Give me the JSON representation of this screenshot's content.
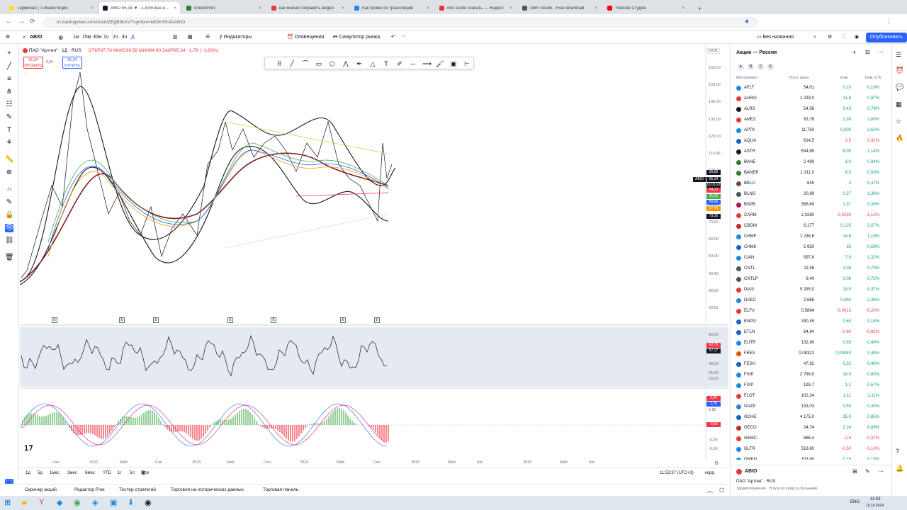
{
  "browser": {
    "tabs": [
      {
        "label": "Терминал | Т‑Инвестиции",
        "color": "#ffdd2d"
      },
      {
        "label": "ABIO 95,34 ▼ −1,83% Без назв",
        "color": "#131722",
        "active": true
      },
      {
        "label": "GreenPrint",
        "color": "#2e7d32"
      },
      {
        "label": "как можно сохранить видео",
        "color": "#e53935"
      },
      {
        "label": "Как провести трансляцию",
        "color": "#1e88e5"
      },
      {
        "label": "obs studio скачать — Яндекс",
        "color": "#e53935"
      },
      {
        "label": "OBS Studio - Free download",
        "color": "#455a64"
      },
      {
        "label": "Youtube Студия",
        "color": "#ff0000"
      }
    ],
    "url": "ru.tradingview.com/chart/ZEgB5kXv/?symbol=MOEX%3AABIO"
  },
  "toolbar": {
    "symbol": "ABIO",
    "intervals": [
      "1м",
      "15м",
      "30м",
      "1ч",
      "2ч",
      "4ч",
      "Д"
    ],
    "indicators": "Индикаторы",
    "alerts": "Оповещения",
    "replay": "Симулятор рынка",
    "layout_name": "Без названия",
    "publish": "Опубликовать"
  },
  "chart": {
    "legend_title": "ПАО \"Артген\" · 1Д · RUS",
    "ohlc": "ОТКР97,78 МАКС99,58 МИН94,90 ЗАКР95,34 −1,78 (−1,83%)",
    "sell_price": "95,34",
    "sell_label": "ПРОДАТЬ",
    "spread": "0,00",
    "buy_price": "95,34",
    "buy_label": "КУПИТЬ",
    "currency": "RUB",
    "price_axis": [
      "160,00",
      "150,00",
      "140,00",
      "130,00",
      "120,00",
      "110,00",
      "100,00",
      "90,00",
      "80,00",
      "70,00",
      "60,00",
      "50,00",
      "40,00",
      "30,00",
      "20,00"
    ],
    "price_tags": [
      {
        "text": "99,89",
        "color": "#131722"
      },
      {
        "text": "95,34",
        "color": "#131722"
      },
      {
        "text": "11:06:22",
        "color": "#131722"
      },
      {
        "text": "94,23",
        "color": "#f23645"
      },
      {
        "text": "91,22",
        "color": "#4caf50"
      },
      {
        "text": "89,60",
        "color": "#2962ff"
      },
      {
        "text": "87,49",
        "color": "#ff9800"
      },
      {
        "text": "73,35",
        "color": "#131722"
      }
    ],
    "symbol_tag": "ABIO",
    "rsi_axis": [
      "80,00",
      "40,00",
      "20,00"
    ],
    "rsi_tags": [
      {
        "text": "62,75",
        "color": "#f23645"
      },
      {
        "text": "57,17",
        "color": "#131722"
      }
    ],
    "rsi_extra": "25,63",
    "macd_axis": [
      "2,50",
      "-2,50",
      "-5,00"
    ],
    "macd_tags": [
      {
        "text": "3,94",
        "color": "#f23645"
      },
      {
        "text": "2,76",
        "color": "#2962ff"
      },
      {
        "text": "-0,18",
        "color": "#f23645"
      }
    ],
    "time_axis": [
      "Сен",
      "2022",
      "Май",
      "Сен",
      "2023",
      "Май",
      "Сен",
      "2024",
      "Май",
      "Сен",
      "2025",
      "Май",
      "Авг",
      "2026",
      "Май",
      "Авг"
    ],
    "earnings_marker": "E",
    "bottom_ranges": [
      "1д",
      "5д",
      "1мес",
      "3мес",
      "6мес",
      "YTD",
      "1г",
      "5л",
      "Все"
    ],
    "clock": "11:53:37 (UTC+3)",
    "adj": "корр."
  },
  "bottom_panels": [
    "Скринер акций",
    "Редактор Pine",
    "Тестер стратегий",
    "Торговля на исторических данных",
    "Торговая панель"
  ],
  "watchlist": {
    "title": "Акции — Россия",
    "columns": [
      "Инструмент",
      "Посл. цена",
      "Изм.",
      "Изм. в %"
    ],
    "rows": [
      {
        "sym": "AFLT",
        "price": "54,01",
        "ch": "0,10",
        "chp": "0,19%",
        "dir": "pos",
        "ic": "#1e88e5"
      },
      {
        "sym": "AGRO",
        "price": "1 233,0",
        "ch": "11,8",
        "chp": "0,97%",
        "dir": "pos",
        "ic": "#e53935"
      },
      {
        "sym": "ALRS",
        "price": "54,56",
        "ch": "0,43",
        "chp": "0,79%",
        "dir": "pos",
        "ic": "#131722"
      },
      {
        "sym": "AMEZ",
        "price": "93,78",
        "ch": "2,38",
        "chp": "2,60%",
        "dir": "pos",
        "ic": "#e53935"
      },
      {
        "sym": "APTK",
        "price": "11,750",
        "ch": "0,300",
        "chp": "2,62%",
        "dir": "pos",
        "ic": "#1e88e5"
      },
      {
        "sym": "AQUA",
        "price": "614,5",
        "ch": "2,5",
        "chp": "0,41%",
        "dir": "neg",
        "ic": "#1565c0"
      },
      {
        "sym": "ASTR",
        "price": "534,65",
        "ch": "6,05",
        "chp": "1,14%",
        "dir": "pos",
        "ic": "#131722"
      },
      {
        "sym": "BANE",
        "price": "2 490",
        "ch": "1,0",
        "chp": "0,04%",
        "dir": "pos",
        "ic": "#2e7d32"
      },
      {
        "sym": "BANEP",
        "price": "1 311,0",
        "ch": "6,5",
        "chp": "0,50%",
        "dir": "pos",
        "ic": "#2e7d32"
      },
      {
        "sym": "BELU",
        "price": "645",
        "ch": "3",
        "chp": "0,47%",
        "dir": "pos",
        "ic": "#6d4c41"
      },
      {
        "sym": "BLNG",
        "price": "20,89",
        "ch": "0,27",
        "chp": "1,36%",
        "dir": "pos",
        "ic": "#455a64"
      },
      {
        "sym": "BSPB",
        "price": "356,69",
        "ch": "1,37",
        "chp": "0,39%",
        "dir": "pos",
        "ic": "#ad1457"
      },
      {
        "sym": "CARM",
        "price": "2,0280",
        "ch": "-0,0230",
        "chp": "-1,12%",
        "dir": "neg",
        "ic": "#e53935"
      },
      {
        "sym": "CBOM",
        "price": "6,177",
        "ch": "0,125",
        "chp": "2,07%",
        "dir": "pos",
        "ic": "#c62828"
      },
      {
        "sym": "CHMF",
        "price": "1 238,6",
        "ch": "14,6",
        "chp": "1,19%",
        "dir": "pos",
        "ic": "#1e88e5"
      },
      {
        "sym": "CHMK",
        "price": "5 950",
        "ch": "35",
        "chp": "0,59%",
        "dir": "pos",
        "ic": "#1565c0"
      },
      {
        "sym": "CIAN",
        "price": "597,8",
        "ch": "7,8",
        "chp": "1,32%",
        "dir": "pos",
        "ic": "#1e88e5"
      },
      {
        "sym": "CNTL",
        "price": "11,58",
        "ch": "0,08",
        "chp": "0,70%",
        "dir": "pos",
        "ic": "#455a64"
      },
      {
        "sym": "CNTLP",
        "price": "8,40",
        "ch": "0,06",
        "chp": "0,72%",
        "dir": "pos",
        "ic": "#455a64"
      },
      {
        "sym": "DIAS",
        "price": "5 295,0",
        "ch": "19,5",
        "chp": "0,37%",
        "dir": "pos",
        "ic": "#e53935"
      },
      {
        "sym": "DVEC",
        "price": "2,666",
        "ch": "0,064",
        "chp": "2,46%",
        "dir": "pos",
        "ic": "#1e88e5"
      },
      {
        "sym": "ELFV",
        "price": "0,5864",
        "ch": "-0,0013",
        "chp": "-0,20%",
        "dir": "neg",
        "ic": "#e53935"
      },
      {
        "sym": "ENPG",
        "price": "330,45",
        "ch": "0,60",
        "chp": "0,18%",
        "dir": "pos",
        "ic": "#1565c0"
      },
      {
        "sym": "ETLN",
        "price": "64,94",
        "ch": "-0,60",
        "chp": "-0,92%",
        "dir": "neg",
        "ic": "#1565c0"
      },
      {
        "sym": "EUTR",
        "price": "132,90",
        "ch": "0,65",
        "chp": "0,49%",
        "dir": "pos",
        "ic": "#1e88e5"
      },
      {
        "sym": "FEES",
        "price": "0,08322",
        "ch": "0,00040",
        "chp": "0,48%",
        "dir": "pos",
        "ic": "#e65100"
      },
      {
        "sym": "FESH",
        "price": "47,82",
        "ch": "0,22",
        "chp": "0,46%",
        "dir": "pos",
        "ic": "#1565c0"
      },
      {
        "sym": "FIVE",
        "price": "2 798,0",
        "ch": "18,0",
        "chp": "0,65%",
        "dir": "pos",
        "ic": "#1e88e5"
      },
      {
        "sym": "FIXP",
        "price": "193,7",
        "ch": "1,1",
        "chp": "0,57%",
        "dir": "pos",
        "ic": "#1e88e5"
      },
      {
        "sym": "FLOT",
        "price": "102,24",
        "ch": "1,11",
        "chp": "1,11%",
        "dir": "pos",
        "ic": "#e53935"
      },
      {
        "sym": "GAZP",
        "price": "133,03",
        "ch": "0,53",
        "chp": "0,40%",
        "dir": "pos",
        "ic": "#1e88e5"
      },
      {
        "sym": "GCHE",
        "price": "4 175,0",
        "ch": "35,0",
        "chp": "0,85%",
        "dir": "pos",
        "ic": "#1565c0"
      },
      {
        "sym": "GECO",
        "price": "34,74",
        "ch": "2,24",
        "chp": "6,89%",
        "dir": "pos",
        "ic": "#c62828"
      },
      {
        "sym": "GEMC",
        "price": "666,4",
        "ch": "-2,5",
        "chp": "-0,37%",
        "dir": "neg",
        "ic": "#e53935"
      },
      {
        "sym": "GLTR",
        "price": "518,60",
        "ch": "-0,50",
        "chp": "-0,10%",
        "dir": "neg",
        "ic": "#1e88e5"
      },
      {
        "sym": "GMKN",
        "price": "103,90",
        "ch": "0,16",
        "chp": "0,15%",
        "dir": "pos",
        "ic": "#1e88e5"
      }
    ],
    "footer_symbol": "ABIO",
    "footer_name": "ПАО \"Артген\" · RUS",
    "footer_sector": "Здравоохранение · Услуги по уходу за больными"
  },
  "taskbar": {
    "lang": "ENG",
    "time": "11:53",
    "date": "10.10.2024"
  }
}
